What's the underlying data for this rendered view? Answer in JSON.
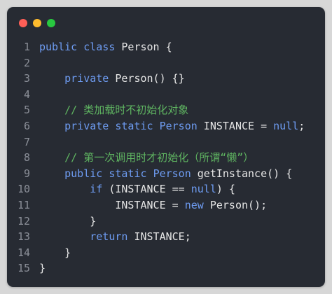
{
  "window": {
    "buttons": {
      "close": "#ff5f57",
      "minimize": "#febc2e",
      "maximize": "#28c840"
    }
  },
  "colors": {
    "line_number": "#8b8f98",
    "plain": "#e6e6e6",
    "keyword": "#6e9cf2",
    "comment": "#5fb561",
    "literal": "#6e9cf2"
  },
  "code": {
    "lines": [
      {
        "n": "1",
        "tokens": [
          {
            "t": "public",
            "k": "keyword"
          },
          {
            "t": " ",
            "k": "plain"
          },
          {
            "t": "class",
            "k": "keyword"
          },
          {
            "t": " Person {",
            "k": "plain"
          }
        ]
      },
      {
        "n": "2",
        "tokens": []
      },
      {
        "n": "3",
        "tokens": [
          {
            "t": "    ",
            "k": "plain"
          },
          {
            "t": "private",
            "k": "keyword"
          },
          {
            "t": " Person() {}",
            "k": "plain"
          }
        ]
      },
      {
        "n": "4",
        "tokens": []
      },
      {
        "n": "5",
        "tokens": [
          {
            "t": "    ",
            "k": "plain"
          },
          {
            "t": "// 类加载时不初始化对象",
            "k": "comment"
          }
        ]
      },
      {
        "n": "6",
        "tokens": [
          {
            "t": "    ",
            "k": "plain"
          },
          {
            "t": "private",
            "k": "keyword"
          },
          {
            "t": " ",
            "k": "plain"
          },
          {
            "t": "static",
            "k": "keyword"
          },
          {
            "t": " ",
            "k": "plain"
          },
          {
            "t": "Person",
            "k": "keyword"
          },
          {
            "t": " INSTANCE = ",
            "k": "plain"
          },
          {
            "t": "null",
            "k": "literal"
          },
          {
            "t": ";",
            "k": "plain"
          }
        ]
      },
      {
        "n": "7",
        "tokens": []
      },
      {
        "n": "8",
        "tokens": [
          {
            "t": "    ",
            "k": "plain"
          },
          {
            "t": "// 第一次调用时才初始化（所谓“懒”）",
            "k": "comment"
          }
        ]
      },
      {
        "n": "9",
        "tokens": [
          {
            "t": "    ",
            "k": "plain"
          },
          {
            "t": "public",
            "k": "keyword"
          },
          {
            "t": " ",
            "k": "plain"
          },
          {
            "t": "static",
            "k": "keyword"
          },
          {
            "t": " ",
            "k": "plain"
          },
          {
            "t": "Person",
            "k": "keyword"
          },
          {
            "t": " getInstance() {",
            "k": "plain"
          }
        ]
      },
      {
        "n": "10",
        "tokens": [
          {
            "t": "        ",
            "k": "plain"
          },
          {
            "t": "if",
            "k": "keyword"
          },
          {
            "t": " (INSTANCE == ",
            "k": "plain"
          },
          {
            "t": "null",
            "k": "literal"
          },
          {
            "t": ") {",
            "k": "plain"
          }
        ]
      },
      {
        "n": "11",
        "tokens": [
          {
            "t": "            INSTANCE = ",
            "k": "plain"
          },
          {
            "t": "new",
            "k": "keyword"
          },
          {
            "t": " Person();",
            "k": "plain"
          }
        ]
      },
      {
        "n": "12",
        "tokens": [
          {
            "t": "        }",
            "k": "plain"
          }
        ]
      },
      {
        "n": "13",
        "tokens": [
          {
            "t": "        ",
            "k": "plain"
          },
          {
            "t": "return",
            "k": "keyword"
          },
          {
            "t": " INSTANCE;",
            "k": "plain"
          }
        ]
      },
      {
        "n": "14",
        "tokens": [
          {
            "t": "    }",
            "k": "plain"
          }
        ]
      },
      {
        "n": "15",
        "tokens": [
          {
            "t": "}",
            "k": "plain"
          }
        ]
      }
    ]
  }
}
